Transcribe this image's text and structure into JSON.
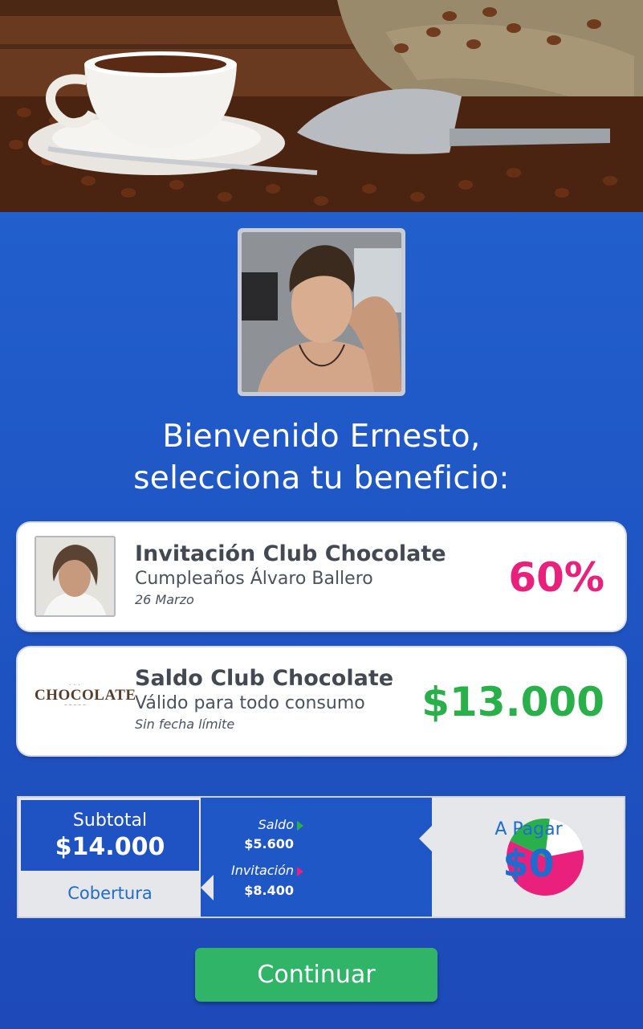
{
  "hero": {
    "image": "coffee-cup-and-beans-photo"
  },
  "user": {
    "avatar": "user-profile-photo"
  },
  "headline": {
    "line1": "Bienvenido Ernesto,",
    "line2": "selecciona tu beneficio:"
  },
  "benefits": [
    {
      "title": "Invitación Club Chocolate",
      "subtitle": "Cumpleaños Álvaro Ballero",
      "note": "26 Marzo",
      "value": "60%",
      "value_color": "#e9207c",
      "thumb": "friend-profile-photo"
    },
    {
      "title": "Saldo Club Chocolate",
      "subtitle": "Válido para todo consumo",
      "note": "Sin fecha límite",
      "value": "$13.000",
      "value_color": "#2ab04a",
      "logo": {
        "text": "CHOCOLATE"
      }
    }
  ],
  "summary": {
    "subtotal_label": "Subtotal",
    "subtotal_value": "$14.000",
    "coverage_label": "Cobertura",
    "saldo_label": "Saldo",
    "saldo_value": "$5.600",
    "invitacion_label": "Invitación",
    "invitacion_value": "$8.400",
    "pie": [
      {
        "label": "Saldo",
        "share": 0.2,
        "color": "#2ab04a"
      },
      {
        "label": "Invitación",
        "share": 0.6,
        "color": "#e9207c"
      },
      {
        "label": "A Pagar",
        "share": 0.2,
        "color": "#ffffff"
      }
    ],
    "pay_label": "A Pagar",
    "pay_value": "$0"
  },
  "continue_label": "Continuar"
}
